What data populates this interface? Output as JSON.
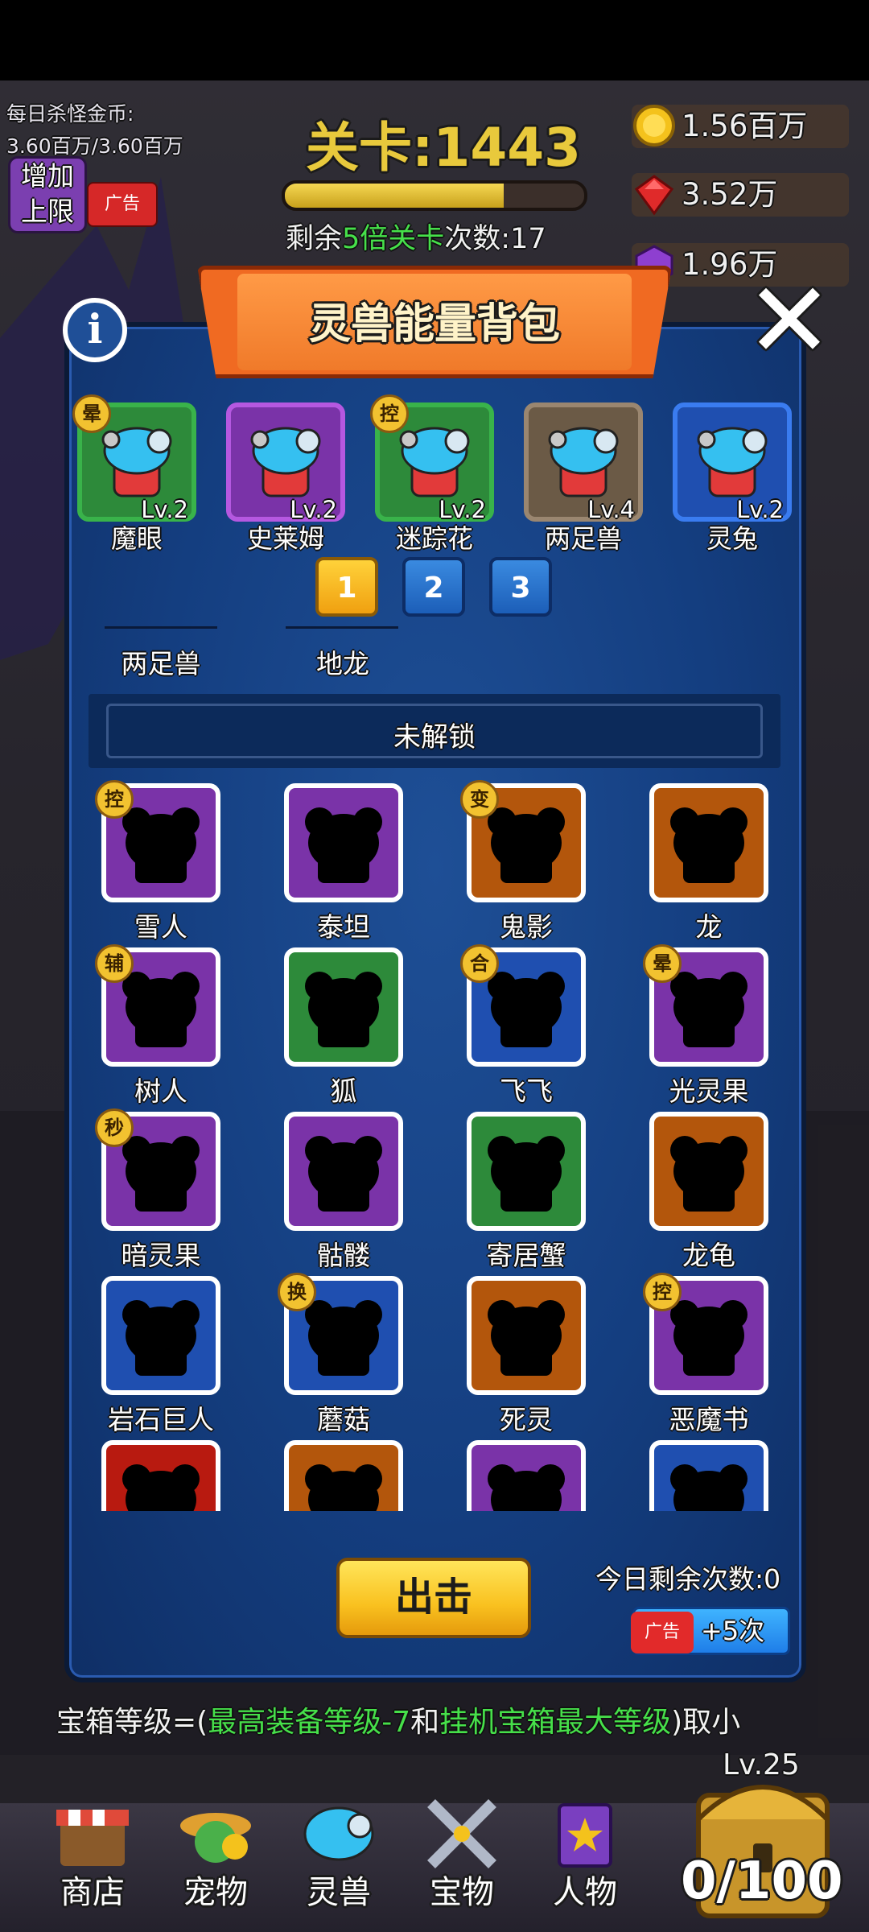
{
  "hud": {
    "kill_gold_label": "每日杀怪金币:",
    "kill_gold_value": "3.60百万/3.60百万",
    "add_limit_line1": "增加",
    "add_limit_line2": "上限",
    "ad_label": "广告",
    "level_title": "关卡:1443",
    "level_progress": 0.73,
    "remain_prefix": "剩余",
    "remain_highlight": "5倍关卡",
    "remain_suffix": "次数:17",
    "gold": "1.56百万",
    "gem": "3.52万",
    "crystal": "1.96万"
  },
  "panel": {
    "title": "灵兽能量背包",
    "info_icon": "i",
    "close_icon": "✕",
    "equipped": [
      {
        "name": "魔眼",
        "level": "Lv.2",
        "frame": "green",
        "tag": "晕"
      },
      {
        "name": "史莱姆",
        "level": "Lv.2",
        "frame": "purple",
        "tag": ""
      },
      {
        "name": "迷踪花",
        "level": "Lv.2",
        "frame": "green",
        "tag": "控"
      },
      {
        "name": "两足兽",
        "level": "Lv.4",
        "frame": "brown",
        "tag": ""
      },
      {
        "name": "灵兔",
        "level": "Lv.2",
        "frame": "blue",
        "tag": ""
      }
    ],
    "pages": [
      "1",
      "2",
      "3"
    ],
    "active_page": "1",
    "scrolled_names": [
      "两足兽",
      "地龙"
    ],
    "locked_label": "未解锁",
    "locked_pets": [
      {
        "name": "雪人",
        "frame": "purple",
        "tag": "控"
      },
      {
        "name": "泰坦",
        "frame": "purple",
        "tag": ""
      },
      {
        "name": "鬼影",
        "frame": "orange",
        "tag": "变"
      },
      {
        "name": "龙",
        "frame": "orange",
        "tag": ""
      },
      {
        "name": "树人",
        "frame": "purple",
        "tag": "辅"
      },
      {
        "name": "狐",
        "frame": "green",
        "tag": ""
      },
      {
        "name": "飞飞",
        "frame": "blue",
        "tag": "合"
      },
      {
        "name": "光灵果",
        "frame": "purple",
        "tag": "晕"
      },
      {
        "name": "暗灵果",
        "frame": "purple",
        "tag": "秒"
      },
      {
        "name": "骷髅",
        "frame": "purple",
        "tag": ""
      },
      {
        "name": "寄居蟹",
        "frame": "green",
        "tag": ""
      },
      {
        "name": "龙龟",
        "frame": "orange",
        "tag": ""
      },
      {
        "name": "岩石巨人",
        "frame": "blue",
        "tag": ""
      },
      {
        "name": "蘑菇",
        "frame": "blue",
        "tag": "换"
      },
      {
        "name": "死灵",
        "frame": "orange",
        "tag": ""
      },
      {
        "name": "恶魔书",
        "frame": "purple",
        "tag": "控"
      },
      {
        "name": "",
        "frame": "red",
        "tag": ""
      },
      {
        "name": "",
        "frame": "orange",
        "tag": ""
      },
      {
        "name": "",
        "frame": "purple",
        "tag": ""
      },
      {
        "name": "",
        "frame": "blue",
        "tag": ""
      }
    ],
    "attack_label": "出击",
    "today_remain": "今日剩余次数:0",
    "ad_label": "广告",
    "ad_bonus": "+5次"
  },
  "chest_formula": {
    "prefix": "宝箱等级=(",
    "part1": "最高装备等级-7",
    "mid": "和",
    "part2": "挂机宝箱最大等级",
    "suffix": ")取小"
  },
  "nav": [
    {
      "label": "商店",
      "icon": "shop-icon"
    },
    {
      "label": "宠物",
      "icon": "pet-icon"
    },
    {
      "label": "灵兽",
      "icon": "spirit-beast-icon"
    },
    {
      "label": "宝物",
      "icon": "treasure-swords-icon"
    },
    {
      "label": "人物",
      "icon": "character-book-icon"
    }
  ],
  "chest": {
    "level": "Lv.25",
    "count": "0/100"
  },
  "colors": {
    "green": "#2d8a3a",
    "purple": "#7a33a8",
    "brown": "#6b5a46",
    "blue": "#1f4fb0",
    "orange": "#b3560c",
    "red": "#b81a10",
    "accent_gold": "#e8c93c",
    "highlight_green": "#46e04a"
  }
}
